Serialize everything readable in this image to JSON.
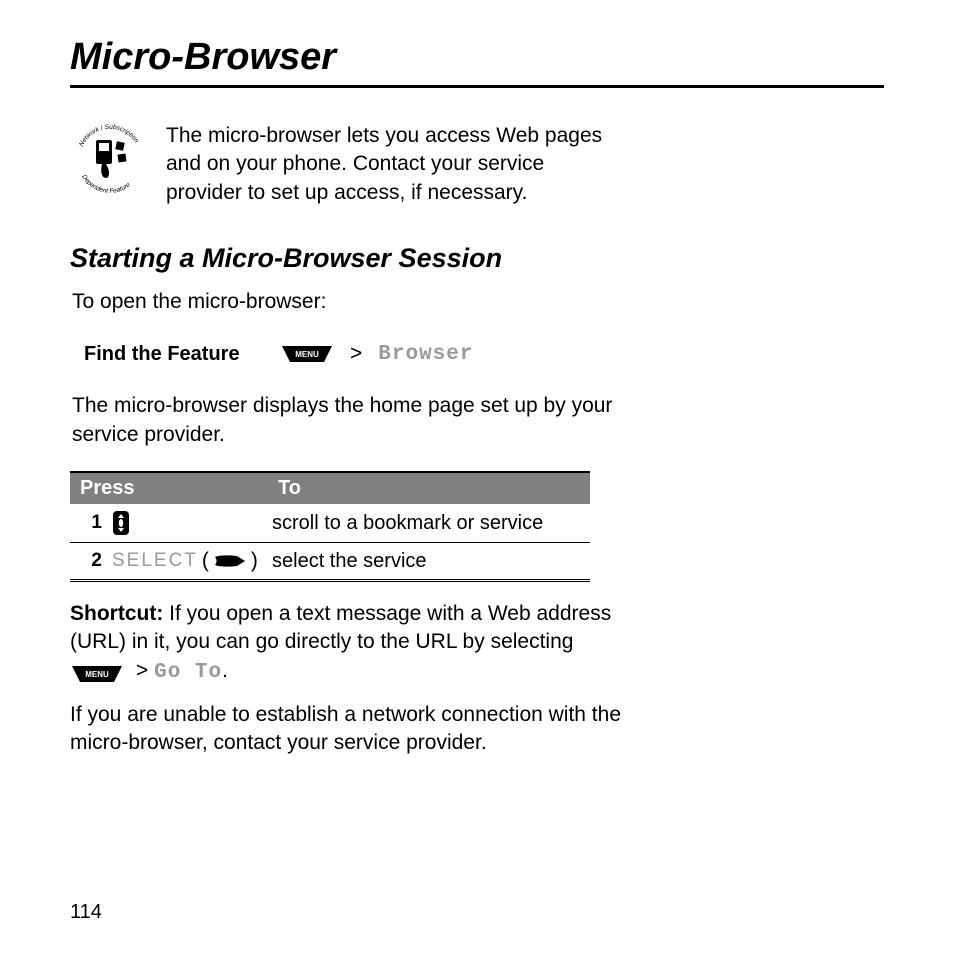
{
  "title": "Micro-Browser",
  "intro": "The micro-browser lets you access Web pages and on your phone. Contact your service provider to set up access, if necessary.",
  "icon_label_top": "Network / Subscription",
  "icon_label_bottom": "Dependent Feature",
  "section_heading": "Starting a Micro-Browser Session",
  "open_line": "To open the micro-browser:",
  "find_label": "Find the Feature",
  "menu_key_text": "MENU",
  "gt": ">",
  "browser_label": "Browser",
  "after_find": "The micro-browser displays the home page set up by your service provider.",
  "table": {
    "col_press": "Press",
    "col_to": "To",
    "rows": [
      {
        "num": "1",
        "to": "scroll to a bookmark or service"
      },
      {
        "num": "2",
        "select_label": "SELECT",
        "to": "select the service"
      }
    ]
  },
  "shortcut_label": "Shortcut:",
  "shortcut_text_a": " If you open a text message with a Web address (URL) in it, you can go directly to the URL by selecting ",
  "goto_label": "Go To",
  "period": ".",
  "trouble": "If you are unable to establish a network connection with the micro-browser, contact your service provider.",
  "page_number": "114"
}
